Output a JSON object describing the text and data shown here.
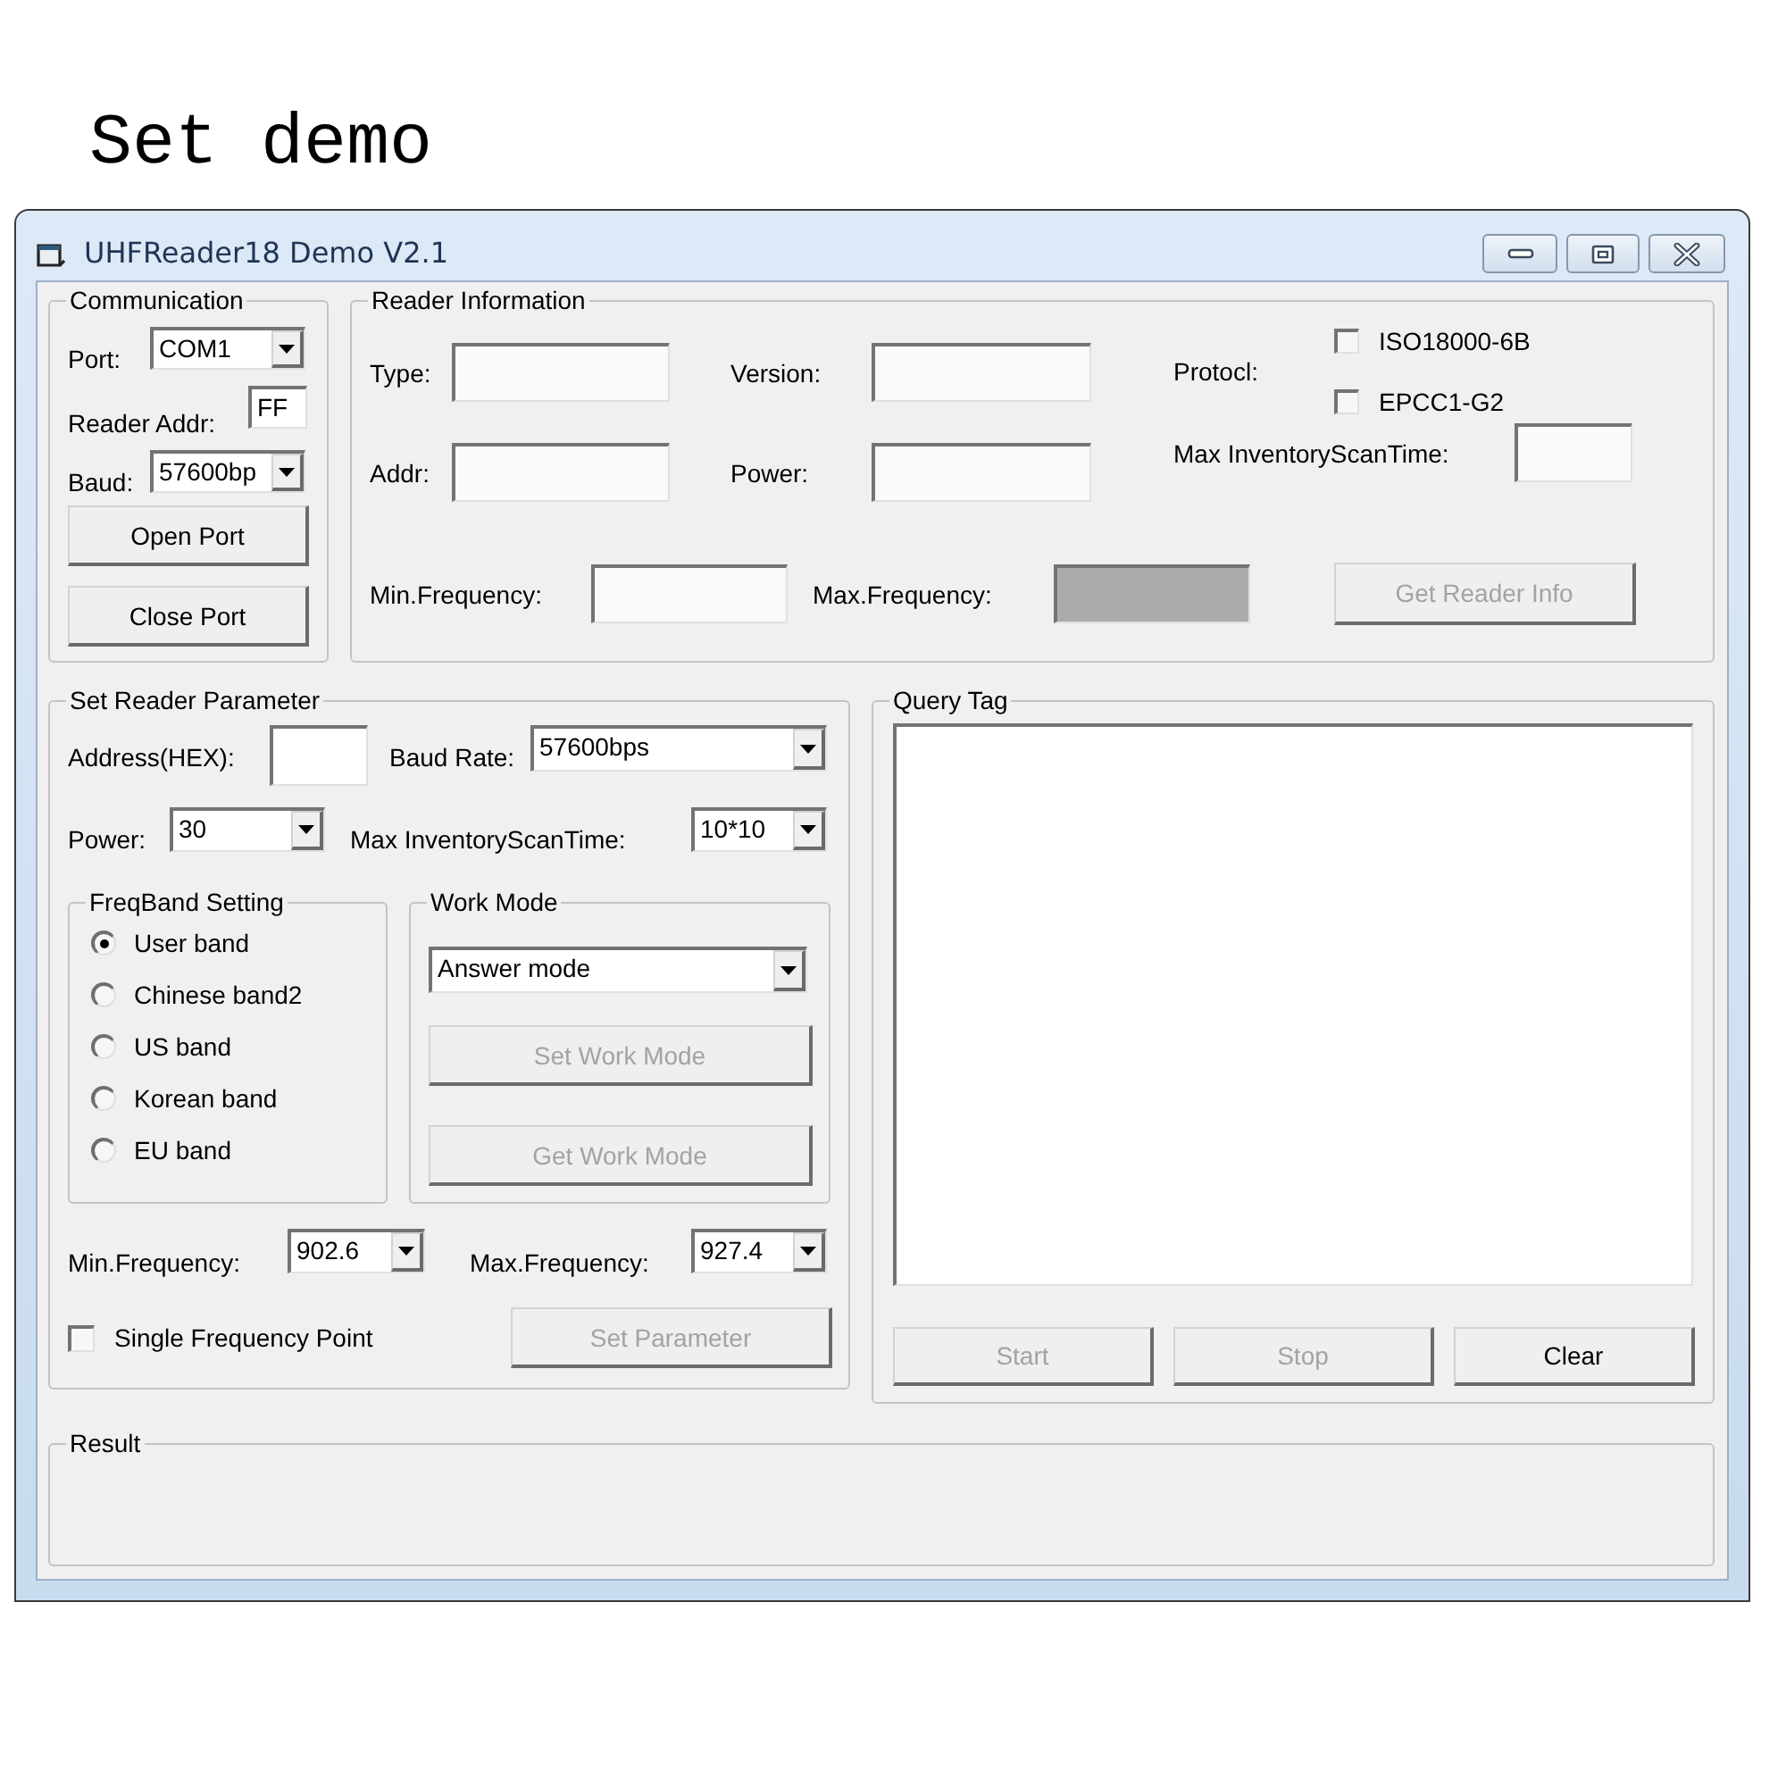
{
  "page_title": "Set demo",
  "window": {
    "title": "UHFReader18 Demo V2.1"
  },
  "communication": {
    "title": "Communication",
    "port": {
      "label": "Port:",
      "value": "COM1"
    },
    "reader_addr": {
      "label": "Reader Addr:",
      "value": "FF"
    },
    "baud": {
      "label": "Baud:",
      "value": "57600bp"
    },
    "buttons": [
      {
        "label": "Open Port",
        "disabled": false
      },
      {
        "label": "Close Port",
        "disabled": false
      }
    ]
  },
  "reader_information": {
    "title": "Reader Information",
    "fields": [
      {
        "label": "Type:"
      },
      {
        "label": "Version:"
      },
      {
        "label": "Addr:"
      },
      {
        "label": "Power:"
      }
    ],
    "protocol": {
      "label": "Protocl:",
      "options": [
        {
          "label": "ISO18000-6B",
          "checked": false
        },
        {
          "label": "EPCC1-G2",
          "checked": false
        }
      ]
    },
    "max_inventory_scan_time": {
      "label": "Max InventoryScanTime:"
    },
    "min_frequency": {
      "label": "Min.Frequency:",
      "disabled": false
    },
    "max_frequency": {
      "label": "Max.Frequency:",
      "disabled": true
    },
    "button": {
      "label": "Get Reader Info",
      "disabled": true
    }
  },
  "set_reader_parameter": {
    "title": "Set Reader Parameter",
    "address": {
      "label": "Address(HEX):"
    },
    "baud_rate": {
      "label": "Baud Rate:",
      "value": "57600bps"
    },
    "power": {
      "label": "Power:",
      "value": "30"
    },
    "max_inventory_scan_time": {
      "label": "Max InventoryScanTime:",
      "value": "10*10"
    },
    "freq_band": {
      "title": "FreqBand Setting",
      "options": [
        {
          "label": "User band",
          "selected": true
        },
        {
          "label": "Chinese band2",
          "selected": false
        },
        {
          "label": "US band",
          "selected": false
        },
        {
          "label": "Korean band",
          "selected": false
        },
        {
          "label": "EU band",
          "selected": false
        }
      ]
    },
    "work_mode": {
      "title": "Work Mode",
      "value": "Answer mode",
      "buttons": [
        {
          "label": "Set Work Mode",
          "disabled": true
        },
        {
          "label": "Get Work Mode",
          "disabled": true
        }
      ]
    },
    "min_frequency": {
      "label": "Min.Frequency:",
      "value": "902.6"
    },
    "max_frequency": {
      "label": "Max.Frequency:",
      "value": "927.4"
    },
    "single_frequency_point": {
      "label": "Single Frequency Point",
      "checked": false
    },
    "button": {
      "label": "Set Parameter",
      "disabled": true
    }
  },
  "query_tag": {
    "title": "Query Tag",
    "buttons": [
      {
        "label": "Start",
        "disabled": true
      },
      {
        "label": "Stop",
        "disabled": true
      },
      {
        "label": "Clear",
        "disabled": false
      }
    ]
  },
  "result": {
    "title": "Result"
  }
}
